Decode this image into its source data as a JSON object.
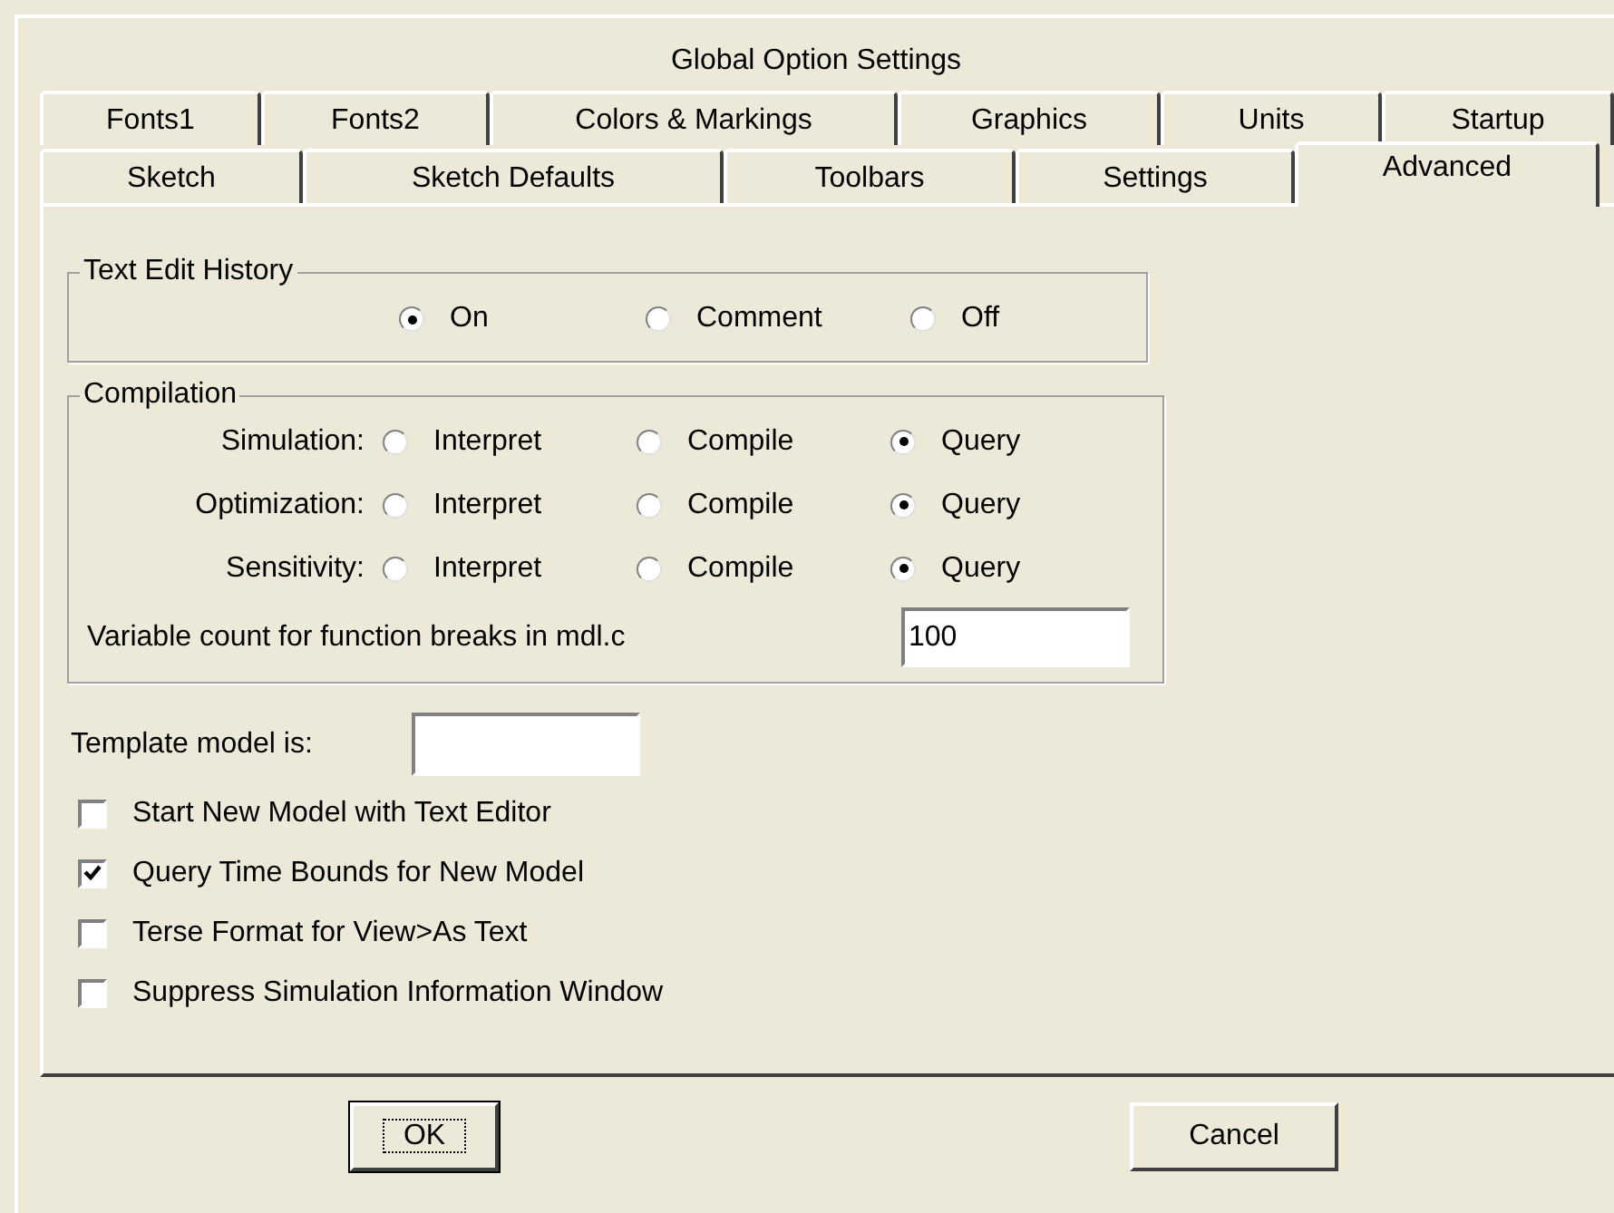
{
  "window": {
    "title": "Global Option Settings"
  },
  "tab_rows": [
    {
      "tabs": [
        {
          "label": "Fonts1",
          "selected": false
        },
        {
          "label": "Fonts2",
          "selected": false
        },
        {
          "label": "Colors & Markings",
          "selected": false
        },
        {
          "label": "Graphics",
          "selected": false
        },
        {
          "label": "Units",
          "selected": false
        },
        {
          "label": "Startup",
          "selected": false
        }
      ]
    },
    {
      "tabs": [
        {
          "label": "Sketch",
          "selected": false
        },
        {
          "label": "Sketch Defaults",
          "selected": false
        },
        {
          "label": "Toolbars",
          "selected": false
        },
        {
          "label": "Settings",
          "selected": false
        },
        {
          "label": "Advanced",
          "selected": true
        }
      ]
    }
  ],
  "text_edit_history": {
    "title": "Text Edit History",
    "options": [
      {
        "label": "On",
        "selected": true
      },
      {
        "label": "Comment",
        "selected": false
      },
      {
        "label": "Off",
        "selected": false
      }
    ]
  },
  "compilation": {
    "title": "Compilation",
    "rows": [
      {
        "label": "Simulation:",
        "options": [
          {
            "label": "Interpret",
            "selected": false
          },
          {
            "label": "Compile",
            "selected": false
          },
          {
            "label": "Query",
            "selected": true
          }
        ]
      },
      {
        "label": "Optimization:",
        "options": [
          {
            "label": "Interpret",
            "selected": false
          },
          {
            "label": "Compile",
            "selected": false
          },
          {
            "label": "Query",
            "selected": true
          }
        ]
      },
      {
        "label": "Sensitivity:",
        "options": [
          {
            "label": "Interpret",
            "selected": false
          },
          {
            "label": "Compile",
            "selected": false
          },
          {
            "label": "Query",
            "selected": true
          }
        ]
      }
    ],
    "variable_count": {
      "label": "Variable count for function breaks in mdl.c",
      "value": "100"
    }
  },
  "template": {
    "label": "Template model is:"
  },
  "checkboxes": [
    {
      "label": "Start New Model with Text Editor",
      "checked": false
    },
    {
      "label": "Query Time Bounds for New Model",
      "checked": true
    },
    {
      "label": "Terse Format for View>As Text",
      "checked": false
    },
    {
      "label": "Suppress Simulation Information Window",
      "checked": false
    }
  ],
  "buttons": [
    {
      "label": "OK",
      "focused": true
    },
    {
      "label": "Cancel",
      "focused": false
    }
  ]
}
